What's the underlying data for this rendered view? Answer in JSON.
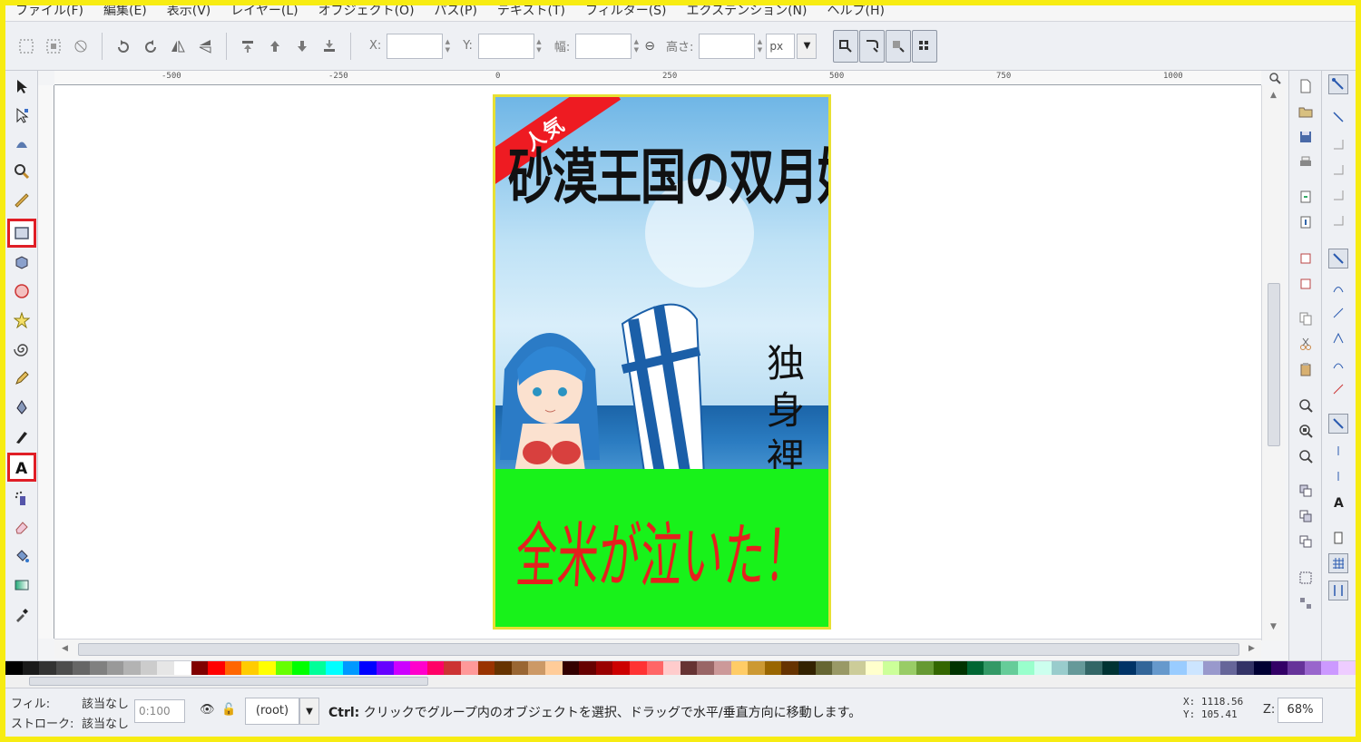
{
  "menubar": {
    "items": [
      "ファイル(F)",
      "編集(E)",
      "表示(V)",
      "レイヤー(L)",
      "オブジェクト(O)",
      "パス(P)",
      "テキスト(T)",
      "フィルター(S)",
      "エクステンション(N)",
      "ヘルプ(H)"
    ]
  },
  "toolbar": {
    "x_label": "X:",
    "y_label": "Y:",
    "w_label": "幅:",
    "h_label": "高さ:",
    "x_value": "",
    "y_value": "",
    "w_value": "",
    "h_value": "",
    "unit": "px"
  },
  "ruler": {
    "labels": [
      "-500",
      "-250",
      "0",
      "250",
      "500",
      "750",
      "1000"
    ]
  },
  "canvas": {
    "ribbon": "人気",
    "title_line": "砂漠王国の双月姫",
    "vertical_lines": [
      "独",
      "身",
      "裡"
    ],
    "banner": "全米が泣いた！"
  },
  "status": {
    "fill_label": "フィル:",
    "fill_value": "該当なし",
    "stroke_label": "ストローク:",
    "stroke_value": "該当なし",
    "opacity": "0:100",
    "layer": "(root)",
    "message_key": "Ctrl:",
    "message": " クリックでグループ内のオブジェクトを選択、ドラッグで水平/垂直方向に移動します。",
    "x_coord": "X: 1118.56",
    "y_coord": "Y:  105.41",
    "zoom_label": "Z:",
    "zoom": "68%"
  },
  "colors": {
    "frame": "#f7ec12",
    "highlight": "#e01e26",
    "banner_bg": "#18f21a",
    "banner_text": "#e5201e",
    "ribbon": "#ee1b22"
  },
  "palette": [
    "#000000",
    "#1a1a1a",
    "#333333",
    "#4d4d4d",
    "#666666",
    "#808080",
    "#999999",
    "#b3b3b3",
    "#cccccc",
    "#e6e6e6",
    "#ffffff",
    "#800000",
    "#ff0000",
    "#ff6600",
    "#ffcc00",
    "#ffff00",
    "#66ff00",
    "#00ff00",
    "#00ff99",
    "#00ffff",
    "#0099ff",
    "#0000ff",
    "#6600ff",
    "#cc00ff",
    "#ff00cc",
    "#ff0066",
    "#cc3333",
    "#ff9999",
    "#993300",
    "#663300",
    "#996633",
    "#cc9966",
    "#ffcc99",
    "#330000",
    "#660000",
    "#990000",
    "#cc0000",
    "#ff3333",
    "#ff6666",
    "#ffcccc",
    "#663333",
    "#996666",
    "#cc9999",
    "#ffcc66",
    "#cc9933",
    "#996600",
    "#663300",
    "#332200",
    "#666633",
    "#999966",
    "#cccc99",
    "#ffffcc",
    "#ccff99",
    "#99cc66",
    "#669933",
    "#336600",
    "#003300",
    "#006633",
    "#339966",
    "#66cc99",
    "#99ffcc",
    "#ccffee",
    "#99cccc",
    "#669999",
    "#336666",
    "#003333",
    "#003366",
    "#336699",
    "#6699cc",
    "#99ccff",
    "#cce5ff",
    "#9999cc",
    "#666699",
    "#333366",
    "#000033",
    "#330066",
    "#663399",
    "#9966cc",
    "#cc99ff",
    "#eeccff"
  ]
}
